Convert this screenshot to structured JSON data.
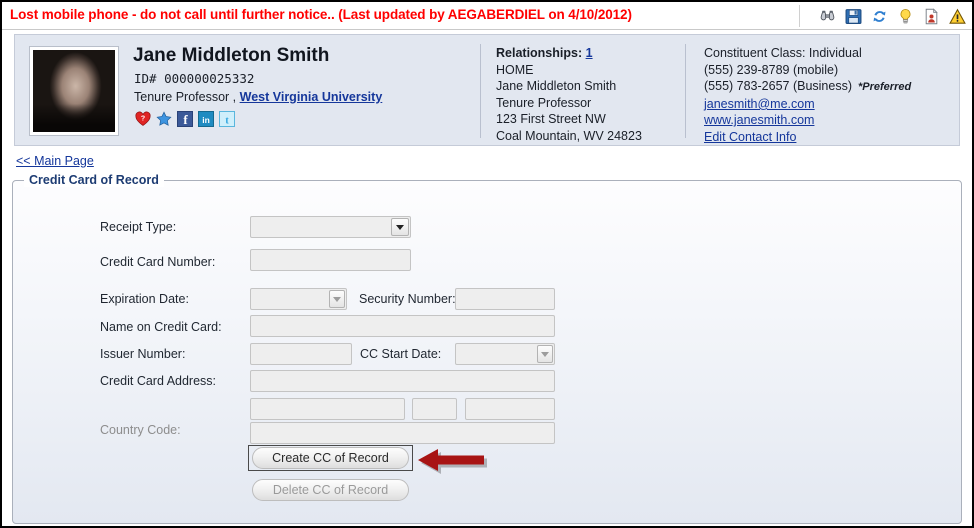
{
  "alert": {
    "text": "Lost mobile phone - do not call until further notice.. (Last updated by AEGABERDIEL  on 4/10/2012)",
    "color": "#ff0000"
  },
  "toolbar": {
    "icons": [
      {
        "name": "binoculars-icon",
        "title": "Search"
      },
      {
        "name": "save-icon",
        "title": "Save"
      },
      {
        "name": "refresh-icon",
        "title": "Refresh"
      },
      {
        "name": "lightbulb-icon",
        "title": "Tips"
      },
      {
        "name": "document-person-icon",
        "title": "Report"
      },
      {
        "name": "warning-icon",
        "title": "Alert"
      }
    ]
  },
  "constituent": {
    "name": "Jane Middleton Smith",
    "id_label": "ID# 000000025332",
    "title": "Tenure Professor ,",
    "organization": "West Virginia University",
    "social": [
      {
        "name": "heart-icon",
        "glyph": "?"
      },
      {
        "name": "star-icon",
        "glyph": ""
      },
      {
        "name": "facebook-icon",
        "glyph": "f"
      },
      {
        "name": "linkedin-icon",
        "glyph": "in"
      },
      {
        "name": "twitter-icon",
        "glyph": "t"
      }
    ]
  },
  "relationships": {
    "heading": "Relationships:",
    "count": "1",
    "lines": [
      "HOME",
      "Jane Middleton Smith",
      "Tenure Professor",
      "123 First Street NW",
      "Coal Mountain, WV 24823"
    ]
  },
  "contact": {
    "constituent_class": "Constituent Class: Individual",
    "phone_mobile": "(555) 239-8789 (mobile)",
    "phone_business": "(555) 783-2657 (Business)",
    "preferred_marker": "*Preferred",
    "email": "janesmith@me.com",
    "website": "www.janesmith.com",
    "edit_link": "Edit Contact Info"
  },
  "navigation": {
    "main_page_link": "<< Main Page"
  },
  "form": {
    "legend": "Credit Card of Record",
    "fields": {
      "receipt_type": {
        "label": "Receipt Type:",
        "value": "",
        "type": "select"
      },
      "credit_card_number": {
        "label": "Credit Card Number:",
        "value": "",
        "type": "text"
      },
      "expiration_date": {
        "label": "Expiration  Date:",
        "value": "",
        "type": "select"
      },
      "security_number": {
        "label": "Security Number:",
        "value": "",
        "type": "text"
      },
      "name_on_credit_card": {
        "label": "Name on Credit Card:",
        "value": "",
        "type": "text"
      },
      "issuer_number": {
        "label": "Issuer Number:",
        "value": "",
        "type": "text"
      },
      "cc_start_date": {
        "label": "CC Start Date:",
        "value": "",
        "type": "select"
      },
      "credit_card_address": {
        "label": "Credit Card Address:",
        "value": "",
        "type": "text"
      },
      "address_city": {
        "label": "",
        "value": "",
        "type": "text"
      },
      "address_state": {
        "label": "",
        "value": "",
        "type": "text"
      },
      "address_zip": {
        "label": "",
        "value": "",
        "type": "text"
      },
      "country_code": {
        "label": "Country Code:",
        "value": "",
        "type": "text",
        "disabled": true
      }
    },
    "buttons": {
      "create": {
        "label": "Create CC of Record",
        "enabled": true,
        "focused": true
      },
      "delete": {
        "label": "Delete CC of Record",
        "enabled": false
      }
    }
  },
  "annotation": {
    "arrow_color": "#a81414",
    "points_to": "Create CC of Record"
  }
}
